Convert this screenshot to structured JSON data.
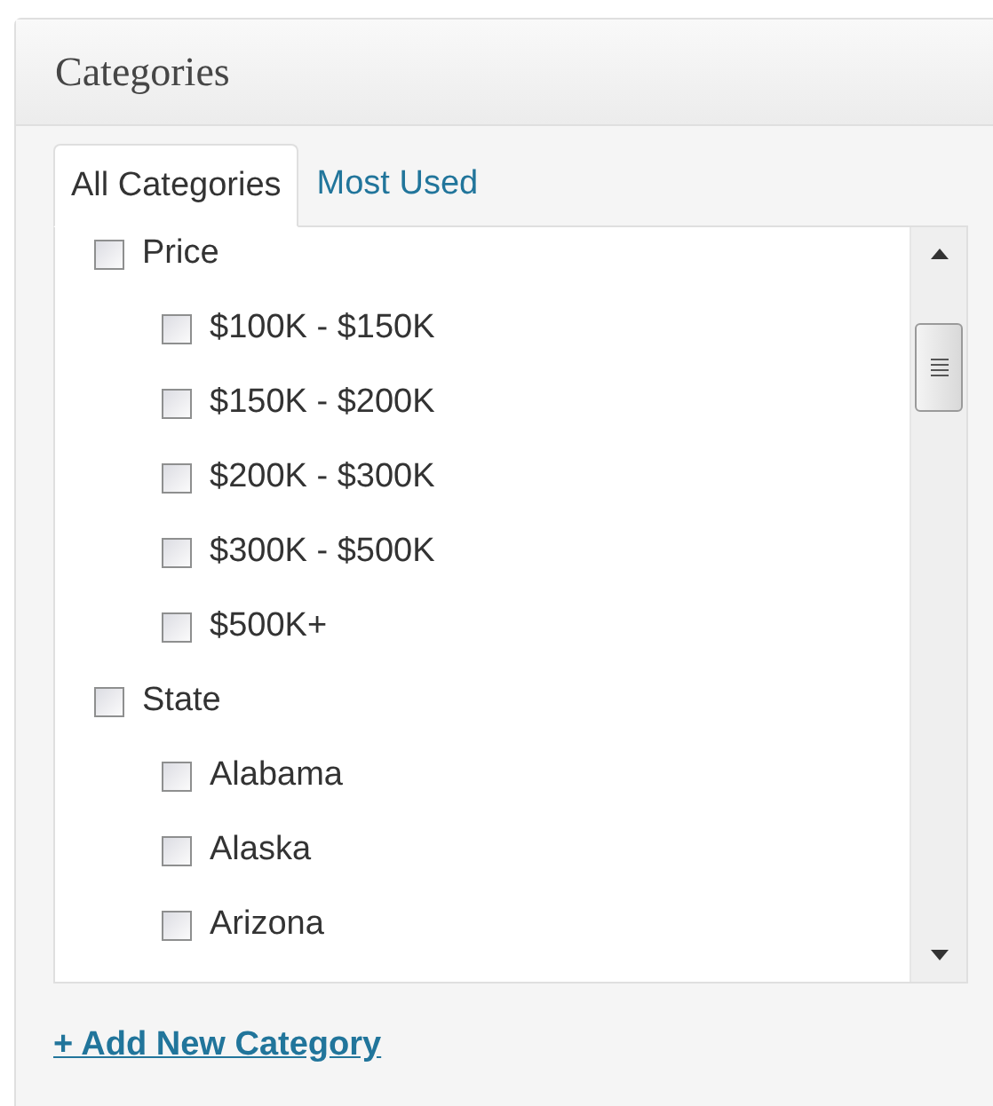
{
  "panel": {
    "title": "Categories"
  },
  "tabs": [
    {
      "label": "All Categories",
      "selected": true
    },
    {
      "label": "Most Used",
      "selected": false
    }
  ],
  "categories": [
    {
      "label": "Price",
      "checked": false,
      "children": [
        {
          "label": "$100K - $150K",
          "checked": false
        },
        {
          "label": "$150K - $200K",
          "checked": false
        },
        {
          "label": "$200K - $300K",
          "checked": false
        },
        {
          "label": "$300K - $500K",
          "checked": false
        },
        {
          "label": "$500K+",
          "checked": false
        }
      ]
    },
    {
      "label": "State",
      "checked": false,
      "children": [
        {
          "label": "Alabama",
          "checked": false
        },
        {
          "label": "Alaska",
          "checked": false
        },
        {
          "label": "Arizona",
          "checked": false
        }
      ]
    }
  ],
  "add_link": "+ Add New Category"
}
